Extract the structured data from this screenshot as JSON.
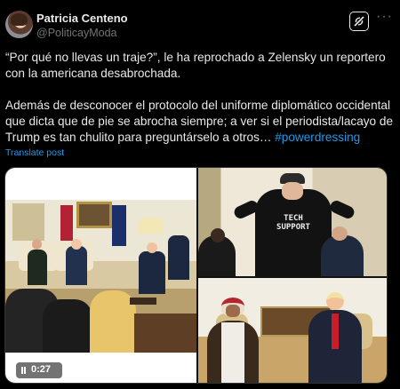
{
  "author": {
    "name": "Patricia Centeno",
    "handle": "@PoliticayModa"
  },
  "post": {
    "line1": "“Por qué no llevas un traje?”, le ha reprochado a Zelensky un reportero con la americana desabrochada.",
    "line2_text": "Además de desconocer el protocolo del uniforme diplomático occidental que dicta que de pie se abrocha siempre; a ver si el periodista/lacayo de Trump es tan chulito para preguntárselo a otros… ",
    "hashtag": "#powerdressing",
    "translate_label": "Translate post"
  },
  "media": {
    "video_time": "0:27",
    "shirt_text": "TECH SUPPORT"
  },
  "icons": {
    "grok": "grok-icon",
    "more": "more-icon",
    "pause": "pause-icon"
  },
  "colors": {
    "link": "#1d9bf0",
    "text": "#e7e9ea",
    "secondary": "#71767b",
    "background": "#000000"
  }
}
